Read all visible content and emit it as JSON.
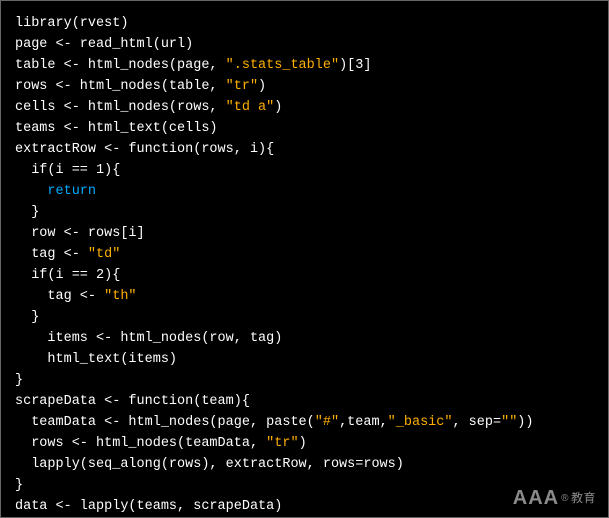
{
  "code": {
    "lines": [
      [
        {
          "t": "library(rvest)",
          "c": "default"
        }
      ],
      [
        {
          "t": "page <- read_html(url)",
          "c": "default"
        }
      ],
      [
        {
          "t": "table <- html_nodes(page, ",
          "c": "default"
        },
        {
          "t": "\".stats_table\"",
          "c": "string"
        },
        {
          "t": ")[3]",
          "c": "default"
        }
      ],
      [
        {
          "t": "rows <- html_nodes(table, ",
          "c": "default"
        },
        {
          "t": "\"tr\"",
          "c": "string"
        },
        {
          "t": ")",
          "c": "default"
        }
      ],
      [
        {
          "t": "cells <- html_nodes(rows, ",
          "c": "default"
        },
        {
          "t": "\"td a\"",
          "c": "string"
        },
        {
          "t": ")",
          "c": "default"
        }
      ],
      [
        {
          "t": "teams <- html_text(cells)",
          "c": "default"
        }
      ],
      [
        {
          "t": "extractRow <- function(rows, i){",
          "c": "default"
        }
      ],
      [
        {
          "t": "  if(i == 1){",
          "c": "default"
        }
      ],
      [
        {
          "t": "    ",
          "c": "default"
        },
        {
          "t": "return",
          "c": "keyword"
        }
      ],
      [
        {
          "t": "  }",
          "c": "default"
        }
      ],
      [
        {
          "t": "  row <- rows[i]",
          "c": "default"
        }
      ],
      [
        {
          "t": "  tag <- ",
          "c": "default"
        },
        {
          "t": "\"td\"",
          "c": "string"
        }
      ],
      [
        {
          "t": "  if(i == 2){",
          "c": "default"
        }
      ],
      [
        {
          "t": "    tag <- ",
          "c": "default"
        },
        {
          "t": "\"th\"",
          "c": "string"
        }
      ],
      [
        {
          "t": "  }",
          "c": "default"
        }
      ],
      [
        {
          "t": "    items <- html_nodes(row, tag)",
          "c": "default"
        }
      ],
      [
        {
          "t": "    html_text(items)",
          "c": "default"
        }
      ],
      [
        {
          "t": "}",
          "c": "default"
        }
      ],
      [
        {
          "t": "scrapeData <- function(team){",
          "c": "default"
        }
      ],
      [
        {
          "t": "  teamData <- html_nodes(page, paste(",
          "c": "default"
        },
        {
          "t": "\"#\"",
          "c": "string"
        },
        {
          "t": ",team,",
          "c": "default"
        },
        {
          "t": "\"_basic\"",
          "c": "string"
        },
        {
          "t": ", sep=",
          "c": "default"
        },
        {
          "t": "\"\"",
          "c": "string"
        },
        {
          "t": "))",
          "c": "default"
        }
      ],
      [
        {
          "t": "  rows <- html_nodes(teamData, ",
          "c": "default"
        },
        {
          "t": "\"tr\"",
          "c": "string"
        },
        {
          "t": ")",
          "c": "default"
        }
      ],
      [
        {
          "t": "  lapply(seq_along(rows), extractRow, rows=rows)",
          "c": "default"
        }
      ],
      [
        {
          "t": "}",
          "c": "default"
        }
      ],
      [
        {
          "t": "data <- lapply(teams, scrapeData)",
          "c": "default"
        }
      ]
    ]
  },
  "watermark": {
    "big": "AAA",
    "reg": "®",
    "cn": "教育"
  }
}
